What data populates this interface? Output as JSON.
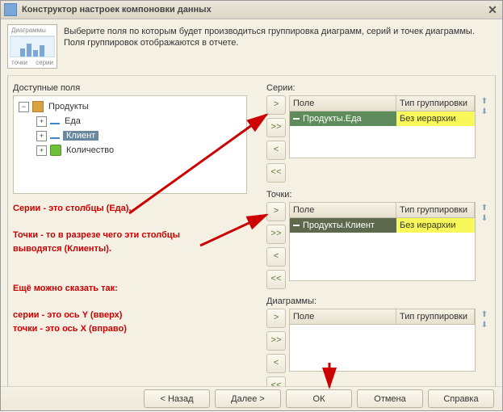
{
  "title": "Конструктор настроек компоновки данных",
  "hint_line1": "Выберите поля по которым будет производиться группировка диаграмм, серий и точек диаграммы.",
  "hint_line2": "Поля группировок отображаются в отчете.",
  "chart_button": {
    "tab": "Диаграммы",
    "l1": "точки",
    "l2": "серии"
  },
  "left": {
    "label": "Доступные поля",
    "tree": {
      "root": "Продукты",
      "items": [
        "Еда",
        "Клиент",
        "Количество"
      ]
    }
  },
  "series": {
    "label": "Серии:",
    "col_field": "Поле",
    "col_group": "Тип группировки",
    "row_field": "Продукты.Еда",
    "row_group": "Без иерархии"
  },
  "points": {
    "label": "Точки:",
    "col_field": "Поле",
    "col_group": "Тип группировки",
    "row_field": "Продукты.Клиент",
    "row_group": "Без иерархии"
  },
  "diagrams": {
    "label": "Диаграммы:",
    "col_field": "Поле",
    "col_group": "Тип группировки"
  },
  "annotations": {
    "a1": "Серии - это столбцы (Еда).",
    "a2a": "Точки - то в разрезе чего эти столбцы",
    "a2b": "выводятся (Клиенты).",
    "a3": "Ещё можно сказать так:",
    "a4": "серии - это ось Y (вверх)",
    "a5": "точки - это ось X (вправо)"
  },
  "move_btns": {
    "r": ">",
    "rr": ">>",
    "l": "<",
    "ll": "<<"
  },
  "arrows": {
    "up": "⬆",
    "down": "⬇"
  },
  "footer": {
    "back": "< Назад",
    "next": "Далее >",
    "ok": "ОК",
    "cancel": "Отмена",
    "help": "Справка"
  }
}
